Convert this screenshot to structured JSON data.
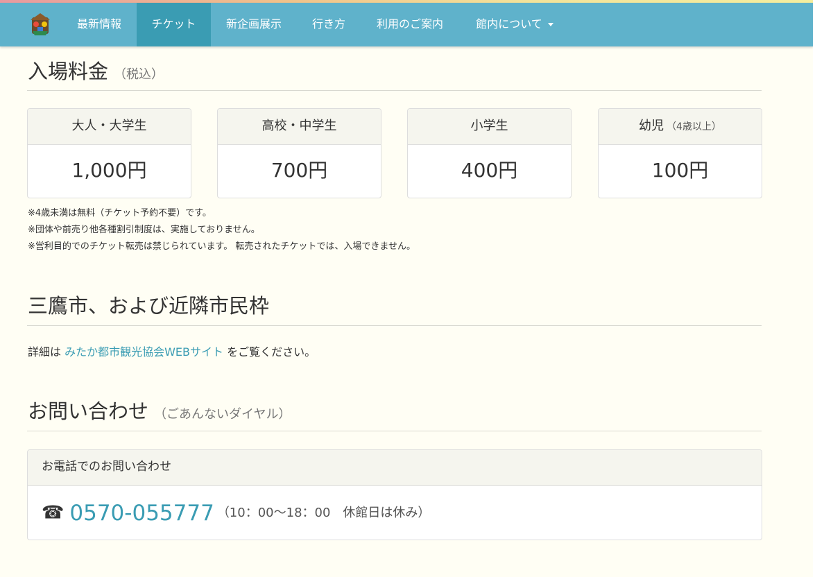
{
  "nav": {
    "items": [
      {
        "label": "最新情報"
      },
      {
        "label": "チケット"
      },
      {
        "label": "新企画展示"
      },
      {
        "label": "行き方"
      },
      {
        "label": "利用のご案内"
      },
      {
        "label": "館内について"
      }
    ],
    "active": "チケット"
  },
  "fees": {
    "title": "入場料金",
    "subtitle": "（税込）",
    "cards": [
      {
        "label": "大人・大学生",
        "note": "",
        "price": "1,000円"
      },
      {
        "label": "高校・中学生",
        "note": "",
        "price": "700円"
      },
      {
        "label": "小学生",
        "note": "",
        "price": "400円"
      },
      {
        "label": "幼児",
        "note": "（4歳以上）",
        "price": "100円"
      }
    ],
    "notes": [
      "※4歳未満は無料（チケット予約不要）です。",
      "※団体や前売り他各種割引制度は、実施しておりません。",
      "※営利目的でのチケット転売は禁じられています。 転売されたチケットでは、入場できません。"
    ]
  },
  "local": {
    "title": "三鷹市、および近隣市民枠",
    "detail_prefix": "詳細は ",
    "link_text": "みたか都市観光協会WEBサイト",
    "detail_suffix": " をご覧ください。"
  },
  "contact": {
    "title": "お問い合わせ",
    "subtitle": "（ごあんないダイヤル）",
    "card_header": "お電話でのお問い合わせ",
    "phone_icon": "☎",
    "phone": "0570-055777",
    "hours": "（10：00〜18：00　休館日は休み）"
  },
  "colors": {
    "navbar": "#5fb2cb",
    "nav_active": "#3a9cb3",
    "link": "#3a9cb3",
    "page_bg": "#fffef4"
  }
}
